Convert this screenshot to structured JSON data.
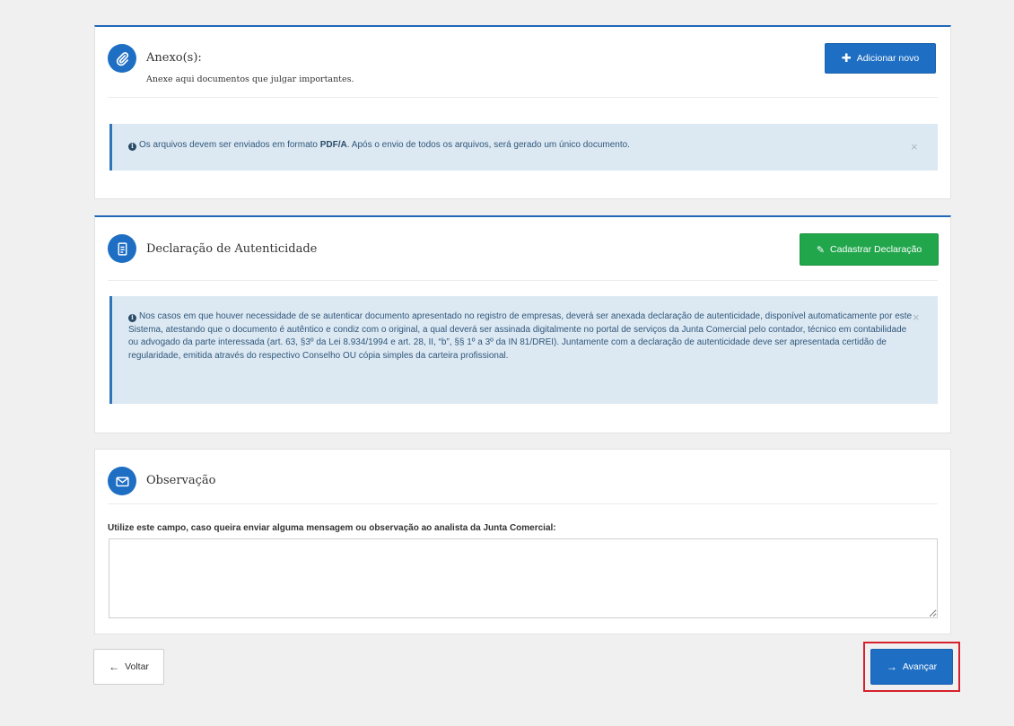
{
  "anexos": {
    "title": "Anexo(s):",
    "subtitle": "Anexe aqui documentos que julgar importantes.",
    "add_button": "Adicionar novo",
    "alert": {
      "text_before": "Os arquivos devem ser enviados em formato ",
      "format": "PDF/A",
      "text_after": ". Após o envio de todos os arquivos, será gerado um único documento."
    }
  },
  "declaracao": {
    "title": "Declaração de Autenticidade",
    "register_button": "Cadastrar Declaração",
    "alert": {
      "text": "Nos casos em que houver necessidade de se autenticar documento apresentado no registro de empresas, deverá ser anexada declaração de autenticidade, disponível automaticamente por este Sistema, atestando que o documento é autêntico e condiz com o original, a qual deverá ser assinada digitalmente no portal de serviços da Junta Comercial pelo contador, técnico em contabilidade ou advogado da parte interessada (art. 63, §3º da Lei 8.934/1994 e art. 28, II, “b”, §§ 1º a 3º da IN 81/DREI). Juntamente com a declaração de autenticidade deve ser apresentada certidão de regularidade, emitida através do respectivo Conselho OU cópia simples da carteira profissional."
    }
  },
  "observacao": {
    "title": "Observação",
    "label": "Utilize este campo, caso queira enviar alguma mensagem ou observação ao analista da Junta Comercial:",
    "value": ""
  },
  "nav": {
    "back_label": "Voltar",
    "next_label": "Avançar"
  },
  "colors": {
    "primary": "#1e6ec4",
    "success": "#22a64c",
    "alert_bg": "#dce9f3",
    "highlight": "#d6212c"
  }
}
